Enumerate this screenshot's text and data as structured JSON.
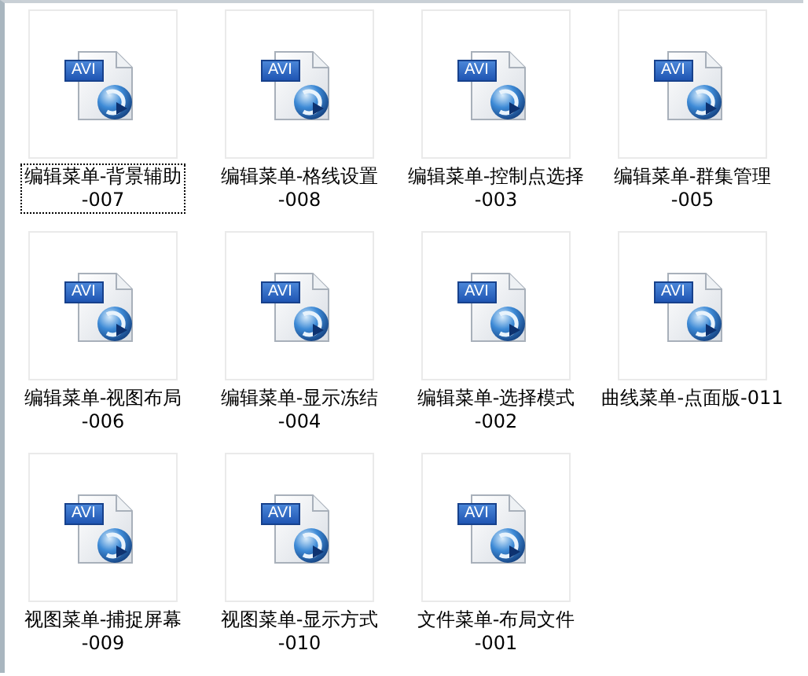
{
  "files": [
    {
      "badge": "AVI",
      "lines": [
        "编辑菜单-背景辅助",
        "-007"
      ],
      "focused": true
    },
    {
      "badge": "AVI",
      "lines": [
        "编辑菜单-格线设置",
        "-008"
      ],
      "focused": false
    },
    {
      "badge": "AVI",
      "lines": [
        "编辑菜单-控制点选择",
        "-003"
      ],
      "focused": false
    },
    {
      "badge": "AVI",
      "lines": [
        "编辑菜单-群集管理",
        "-005"
      ],
      "focused": false
    },
    {
      "badge": "AVI",
      "lines": [
        "编辑菜单-视图布局",
        "-006"
      ],
      "focused": false
    },
    {
      "badge": "AVI",
      "lines": [
        "编辑菜单-显示冻结",
        "-004"
      ],
      "focused": false
    },
    {
      "badge": "AVI",
      "lines": [
        "编辑菜单-选择模式",
        "-002"
      ],
      "focused": false
    },
    {
      "badge": "AVI",
      "lines": [
        "曲线菜单-点面版-011"
      ],
      "focused": false
    },
    {
      "badge": "AVI",
      "lines": [
        "视图菜单-捕捉屏幕",
        "-009"
      ],
      "focused": false
    },
    {
      "badge": "AVI",
      "lines": [
        "视图菜单-显示方式",
        "-010"
      ],
      "focused": false
    },
    {
      "badge": "AVI",
      "lines": [
        "文件菜单-布局文件",
        "-001"
      ],
      "focused": false
    }
  ]
}
